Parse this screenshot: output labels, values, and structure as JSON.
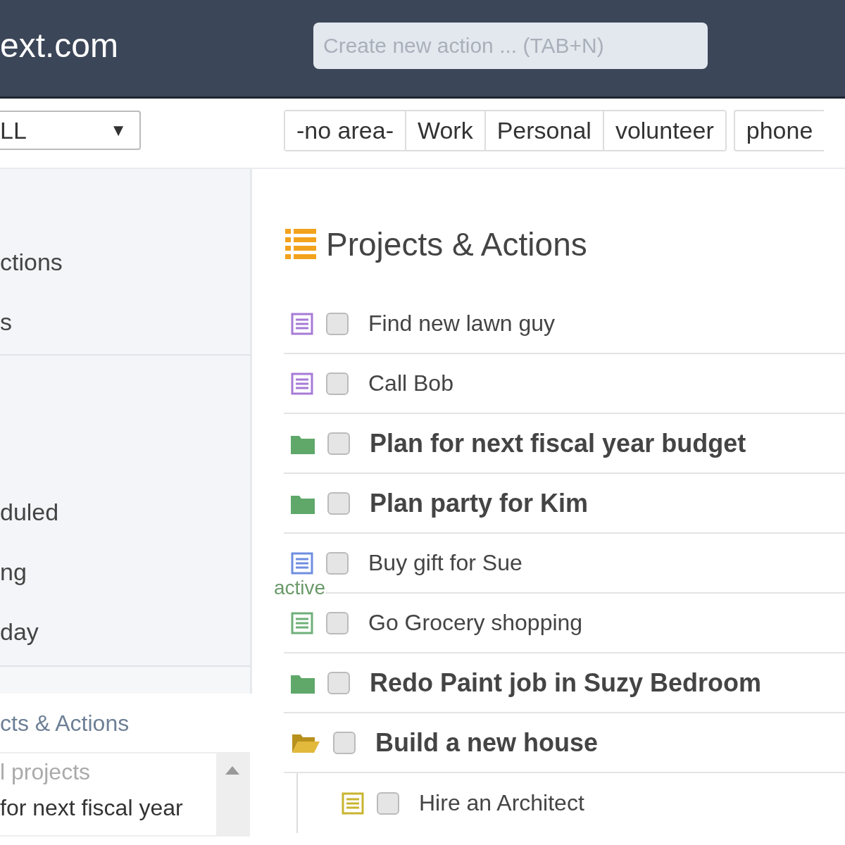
{
  "header": {
    "logo": "ext.com",
    "search": {
      "placeholder": "Create new action ... (TAB+N)"
    }
  },
  "toolbar": {
    "area_select": {
      "value": "LL",
      "arrow": "▼"
    },
    "areas": [
      {
        "label": "-no area-"
      },
      {
        "label": "Work"
      },
      {
        "label": "Personal"
      },
      {
        "label": "volunteer"
      }
    ],
    "extra_area": {
      "label": "phone"
    }
  },
  "sidebar": {
    "groups": [
      [
        "ctions",
        "s"
      ],
      [
        "duled",
        "ng",
        "day"
      ]
    ],
    "section_title": "cts & Actions",
    "list": {
      "items": [
        {
          "text": "l projects",
          "kind": "placeholder"
        },
        {
          "text": "for next fiscal year",
          "kind": "item"
        }
      ]
    }
  },
  "main": {
    "title": "Projects & Actions",
    "rows": [
      {
        "kind": "action",
        "text": "Find new lawn guy",
        "color": "#a77bd6",
        "checked": false
      },
      {
        "kind": "action",
        "text": "Call Bob",
        "color": "#a77bd6",
        "checked": false
      },
      {
        "kind": "project",
        "text": "Plan for next fiscal year budget",
        "expanded": false,
        "checked": false
      },
      {
        "kind": "project",
        "text": "Plan party for Kim",
        "expanded": false,
        "checked": false
      },
      {
        "kind": "action",
        "text": "Buy gift for Sue",
        "color": "#6f8ee0",
        "checked": false,
        "tag": "active"
      },
      {
        "kind": "action",
        "text": "Go Grocery shopping",
        "color": "#6fb07a",
        "checked": false
      },
      {
        "kind": "project",
        "text": "Redo Paint job in Suzy Bedroom",
        "expanded": false,
        "checked": false
      },
      {
        "kind": "project",
        "text": "Build a new house",
        "expanded": true,
        "checked": false,
        "children": [
          {
            "kind": "action",
            "text": "Hire an Architect",
            "color": "#c9b430",
            "checked": false
          }
        ]
      }
    ]
  }
}
